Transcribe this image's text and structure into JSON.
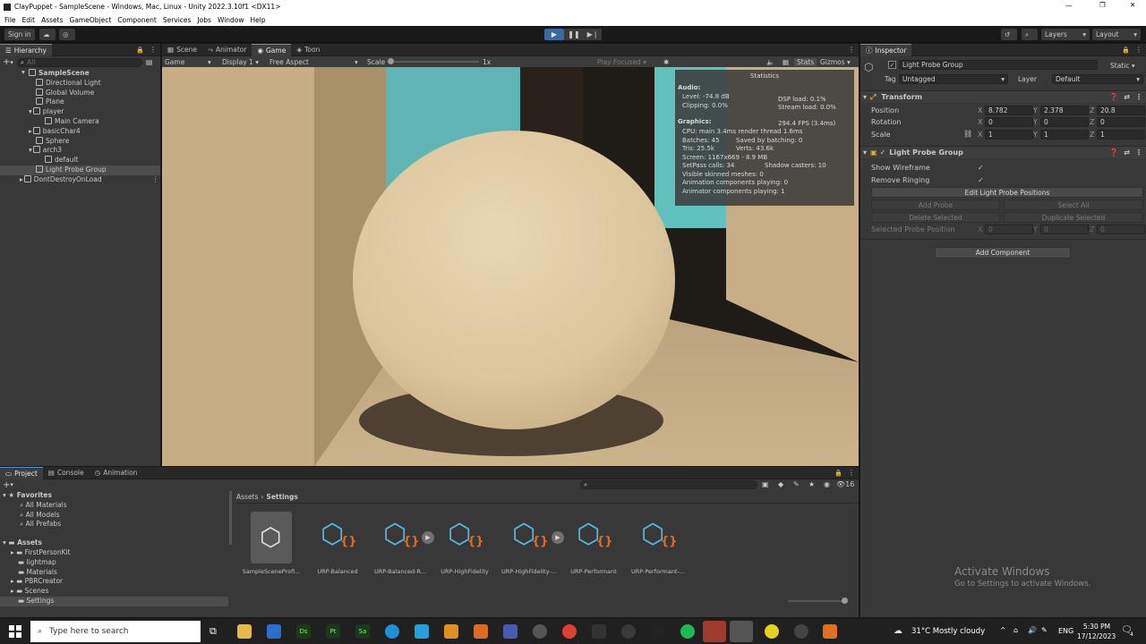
{
  "window": {
    "title": "ClayPuppet - SampleScene - Windows, Mac, Linux - Unity 2022.3.10f1 <DX11>"
  },
  "menu": [
    "File",
    "Edit",
    "Assets",
    "GameObject",
    "Component",
    "Services",
    "Jobs",
    "Window",
    "Help"
  ],
  "toolbar": {
    "sign_in": "Sign in",
    "layers": "Layers",
    "layout": "Layout"
  },
  "hierarchy": {
    "tab": "Hierarchy",
    "search_placeholder": "All",
    "items": [
      {
        "label": "SampleScene",
        "depth": 0,
        "bold": true
      },
      {
        "label": "Directional Light",
        "depth": 1
      },
      {
        "label": "Global Volume",
        "depth": 1
      },
      {
        "label": "Plane",
        "depth": 1
      },
      {
        "label": "player",
        "depth": 1
      },
      {
        "label": "Main Camera",
        "depth": 2
      },
      {
        "label": "basicChar4",
        "depth": 1
      },
      {
        "label": "Sphere",
        "depth": 1
      },
      {
        "label": "arch3",
        "depth": 1
      },
      {
        "label": "default",
        "depth": 2
      },
      {
        "label": "Light Probe Group",
        "depth": 1,
        "selected": true
      },
      {
        "label": "DontDestroyOnLoad",
        "depth": 0
      }
    ]
  },
  "center": {
    "tabs": [
      "Scene",
      "Animator",
      "Game",
      "Toon"
    ],
    "active_tab": "Game",
    "game_bar": {
      "display_mode": "Game",
      "display": "Display 1",
      "aspect": "Free Aspect",
      "scale_label": "Scale",
      "scale_value": "1x",
      "play_focused": "Play Focused",
      "stats": "Stats",
      "gizmos": "Gizmos"
    }
  },
  "stats": {
    "title": "Statistics",
    "audio_header": "Audio:",
    "level": "Level: -74.8 dB",
    "clipping": "Clipping: 0.0%",
    "dsp": "DSP load: 0.1%",
    "stream": "Stream load: 0.0%",
    "graphics_header": "Graphics:",
    "fps": "294.4 FPS (3.4ms)",
    "cpu": "CPU: main 3.4ms  render thread 1.6ms",
    "batches": "Batches: 45",
    "saved_batching": "Saved by batching: 0",
    "tris": "Tris: 25.5k",
    "verts": "Verts: 43.6k",
    "screen": "Screen: 1167x669 - 8.9 MB",
    "setpass": "SetPass calls: 34",
    "shadow_casters": "Shadow casters: 10",
    "skinned": "Visible skinned meshes: 0",
    "anim_playing": "Animation components playing: 0",
    "animator_playing": "Animator components playing: 1"
  },
  "inspector": {
    "tab": "Inspector",
    "object_name": "Light Probe Group",
    "static_label": "Static",
    "tag_label": "Tag",
    "tag_value": "Untagged",
    "layer_label": "Layer",
    "layer_value": "Default",
    "transform": {
      "title": "Transform",
      "position_label": "Position",
      "px": "8.782",
      "py": "2.378",
      "pz": "20.8",
      "rotation_label": "Rotation",
      "rx": "0",
      "ry": "0",
      "rz": "0",
      "scale_label": "Scale",
      "sx": "1",
      "sy": "1",
      "sz": "1"
    },
    "lpg": {
      "title": "Light Probe Group",
      "show_wireframe": "Show Wireframe",
      "remove_ringing": "Remove Ringing",
      "edit_positions": "Edit Light Probe Positions",
      "add_probe": "Add Probe",
      "select_all": "Select All",
      "delete_selected": "Delete Selected",
      "duplicate_selected": "Duplicate Selected",
      "selected_pos": "Selected Probe Position",
      "sel_x": "0",
      "sel_y": "0",
      "sel_z": "0"
    },
    "add_component": "Add Component"
  },
  "bottom": {
    "tabs": [
      "Project",
      "Console",
      "Animation"
    ],
    "favorites_header": "Favorites",
    "favorites": [
      "All Materials",
      "All Models",
      "All Prefabs"
    ],
    "assets_header": "Assets",
    "folders": [
      "FirstPersonKit",
      "lightmap",
      "Materials",
      "PBRCreator",
      "Scenes",
      "Settings"
    ],
    "breadcrumb_root": "Assets",
    "breadcrumb_current": "Settings",
    "count": "16",
    "assets": [
      "SampleSceneProfi...",
      "URP-Balanced",
      "URP-Balanced-R...",
      "URP-HighFidelity",
      "URP-HighFidelity-...",
      "URP-Performant",
      "URP-Performant-..."
    ]
  },
  "watermark": {
    "line1": "Activate Windows",
    "line2": "Go to Settings to activate Windows."
  },
  "taskbar": {
    "search_placeholder": "Type here to search",
    "weather": "31°C  Mostly cloudy",
    "lang": "ENG",
    "time": "5:30 PM",
    "date": "17/12/2023",
    "notif": "4"
  }
}
